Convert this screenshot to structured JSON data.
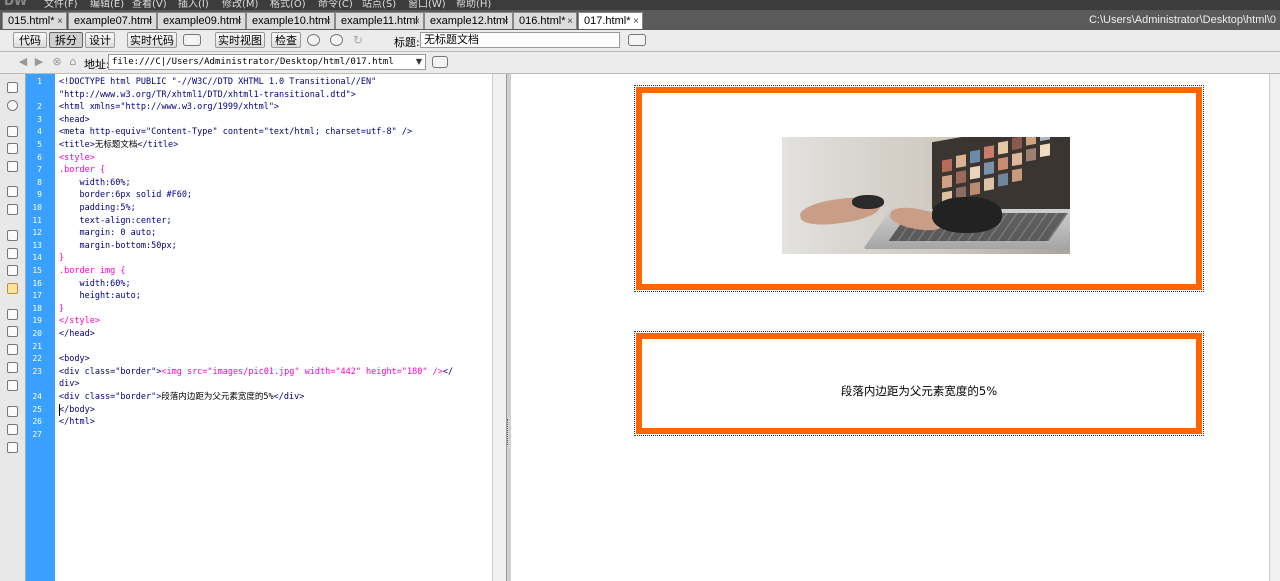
{
  "menubar": {
    "logo": "DW",
    "items": [
      "文件(F)",
      "编辑(E)",
      "查看(V)",
      "插入(I)",
      "修改(M)",
      "格式(O)",
      "命令(C)",
      "站点(S)",
      "窗口(W)",
      "帮助(H)"
    ]
  },
  "tabs": [
    "015.html*",
    "example07.html",
    "example09.html",
    "example10.html",
    "example11.html",
    "example12.html",
    "016.html*",
    "017.html*"
  ],
  "active_tab": "017.html*",
  "file_path": "C:\\Users\\Administrator\\Desktop\\html\\0",
  "toolbar": {
    "code_label": "代码",
    "split_label": "拆分",
    "design_label": "设计",
    "live_code_label": "实时代码",
    "live_view_label": "实时视图",
    "inspect_label": "检查",
    "title_label": "标题:",
    "title_value": "无标题文档"
  },
  "address": {
    "label": "地址:",
    "value": "file:///C|/Users/Administrator/Desktop/html/017.html"
  },
  "code_lines": [
    {
      "n": "1",
      "parts": [
        {
          "c": "t",
          "t": "<!DOCTYPE html PUBLIC \"-//W3C//DTD XHTML 1.0 Transitional//EN\""
        }
      ]
    },
    {
      "n": "",
      "parts": [
        {
          "c": "t",
          "t": "\"http://www.w3.org/TR/xhtml1/DTD/xhtml1-transitional.dtd\">"
        }
      ]
    },
    {
      "n": "2",
      "parts": [
        {
          "c": "t",
          "t": "<html xmlns=\"http://www.w3.org/1999/xhtml\">"
        }
      ]
    },
    {
      "n": "3",
      "parts": [
        {
          "c": "t",
          "t": "<head>"
        }
      ]
    },
    {
      "n": "4",
      "parts": [
        {
          "c": "t",
          "t": "<meta http-equiv=\"Content-Type\" content=\"text/html; charset=utf-8\" />"
        }
      ]
    },
    {
      "n": "5",
      "parts": [
        {
          "c": "t",
          "t": "<title>"
        },
        {
          "c": "",
          "t": "无标题文档"
        },
        {
          "c": "t",
          "t": "</title>"
        }
      ]
    },
    {
      "n": "6",
      "parts": [
        {
          "c": "c",
          "t": "<style>"
        }
      ]
    },
    {
      "n": "7",
      "parts": [
        {
          "c": "c",
          "t": ".border {"
        }
      ]
    },
    {
      "n": "8",
      "parts": [
        {
          "c": "t",
          "t": "    width:60%;"
        }
      ]
    },
    {
      "n": "9",
      "parts": [
        {
          "c": "t",
          "t": "    border:6px solid #F60;"
        }
      ]
    },
    {
      "n": "10",
      "parts": [
        {
          "c": "t",
          "t": "    padding:5%;"
        }
      ]
    },
    {
      "n": "11",
      "parts": [
        {
          "c": "t",
          "t": "    text-align:center;"
        }
      ]
    },
    {
      "n": "12",
      "parts": [
        {
          "c": "t",
          "t": "    margin: 0 auto;"
        }
      ]
    },
    {
      "n": "13",
      "parts": [
        {
          "c": "t",
          "t": "    margin-bottom:50px;"
        }
      ]
    },
    {
      "n": "14",
      "parts": [
        {
          "c": "c",
          "t": "}"
        }
      ]
    },
    {
      "n": "15",
      "parts": [
        {
          "c": "c",
          "t": ".border img {"
        }
      ]
    },
    {
      "n": "16",
      "parts": [
        {
          "c": "t",
          "t": "    width:60%;"
        }
      ]
    },
    {
      "n": "17",
      "parts": [
        {
          "c": "t",
          "t": "    height:auto;"
        }
      ]
    },
    {
      "n": "18",
      "parts": [
        {
          "c": "c",
          "t": "}"
        }
      ]
    },
    {
      "n": "19",
      "parts": [
        {
          "c": "c",
          "t": "</style>"
        }
      ]
    },
    {
      "n": "20",
      "parts": [
        {
          "c": "t",
          "t": "</head>"
        }
      ]
    },
    {
      "n": "21",
      "parts": [
        {
          "c": "",
          "t": ""
        }
      ]
    },
    {
      "n": "22",
      "parts": [
        {
          "c": "t",
          "t": "<body>"
        }
      ]
    },
    {
      "n": "23",
      "parts": [
        {
          "c": "t",
          "t": "<div class=\"border\">"
        },
        {
          "c": "c",
          "t": "<img src=\"images/pic01.jpg\" width=\"442\" height=\"180\" />"
        },
        {
          "c": "t",
          "t": "</"
        }
      ]
    },
    {
      "n": "",
      "parts": [
        {
          "c": "t",
          "t": "div>"
        }
      ]
    },
    {
      "n": "24",
      "parts": [
        {
          "c": "t",
          "t": "<div class=\"border\">"
        },
        {
          "c": "",
          "t": "段落内边距为父元素宽度的5%"
        },
        {
          "c": "t",
          "t": "</div>"
        }
      ]
    },
    {
      "n": "25",
      "parts": [
        {
          "c": "t",
          "t": "</body>"
        }
      ]
    },
    {
      "n": "26",
      "parts": [
        {
          "c": "t",
          "t": "</html>"
        }
      ]
    },
    {
      "n": "27",
      "parts": [
        {
          "c": "",
          "t": ""
        }
      ]
    }
  ],
  "design": {
    "caption": "段落内边距为父元素宽度的5%"
  }
}
